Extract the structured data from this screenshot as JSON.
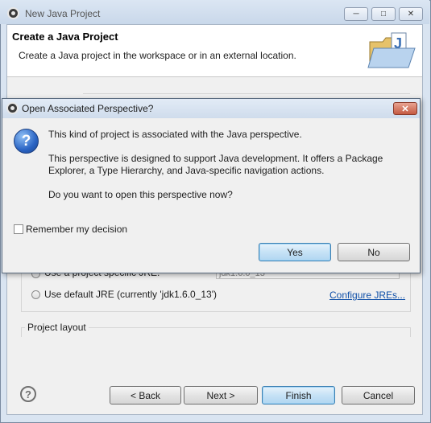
{
  "outer_window": {
    "title": "New Java Project",
    "header_title": "Create a Java Project",
    "header_description": "Create a Java project in the workspace or in an external location."
  },
  "background": {
    "project_specific_option": "Use a project specific JRE:",
    "project_specific_value": "jdk1.6.0_13",
    "default_jre_option": "Use default JRE (currently 'jdk1.6.0_13')",
    "configure_link": "Configure JREs...",
    "project_layout_label": "Project layout"
  },
  "buttons": {
    "back": "< Back",
    "next": "Next >",
    "finish": "Finish",
    "cancel": "Cancel"
  },
  "dialog": {
    "title": "Open Associated Perspective?",
    "message1": "This kind of project is associated with the Java perspective.",
    "message2a": "This perspective is designed to support Java development. It offers a Package",
    "message2b": "Explorer, a Type Hierarchy, and Java-specific navigation actions.",
    "message3": "Do you want to open this perspective now?",
    "remember_label": "Remember my decision",
    "yes": "Yes",
    "no": "No"
  }
}
